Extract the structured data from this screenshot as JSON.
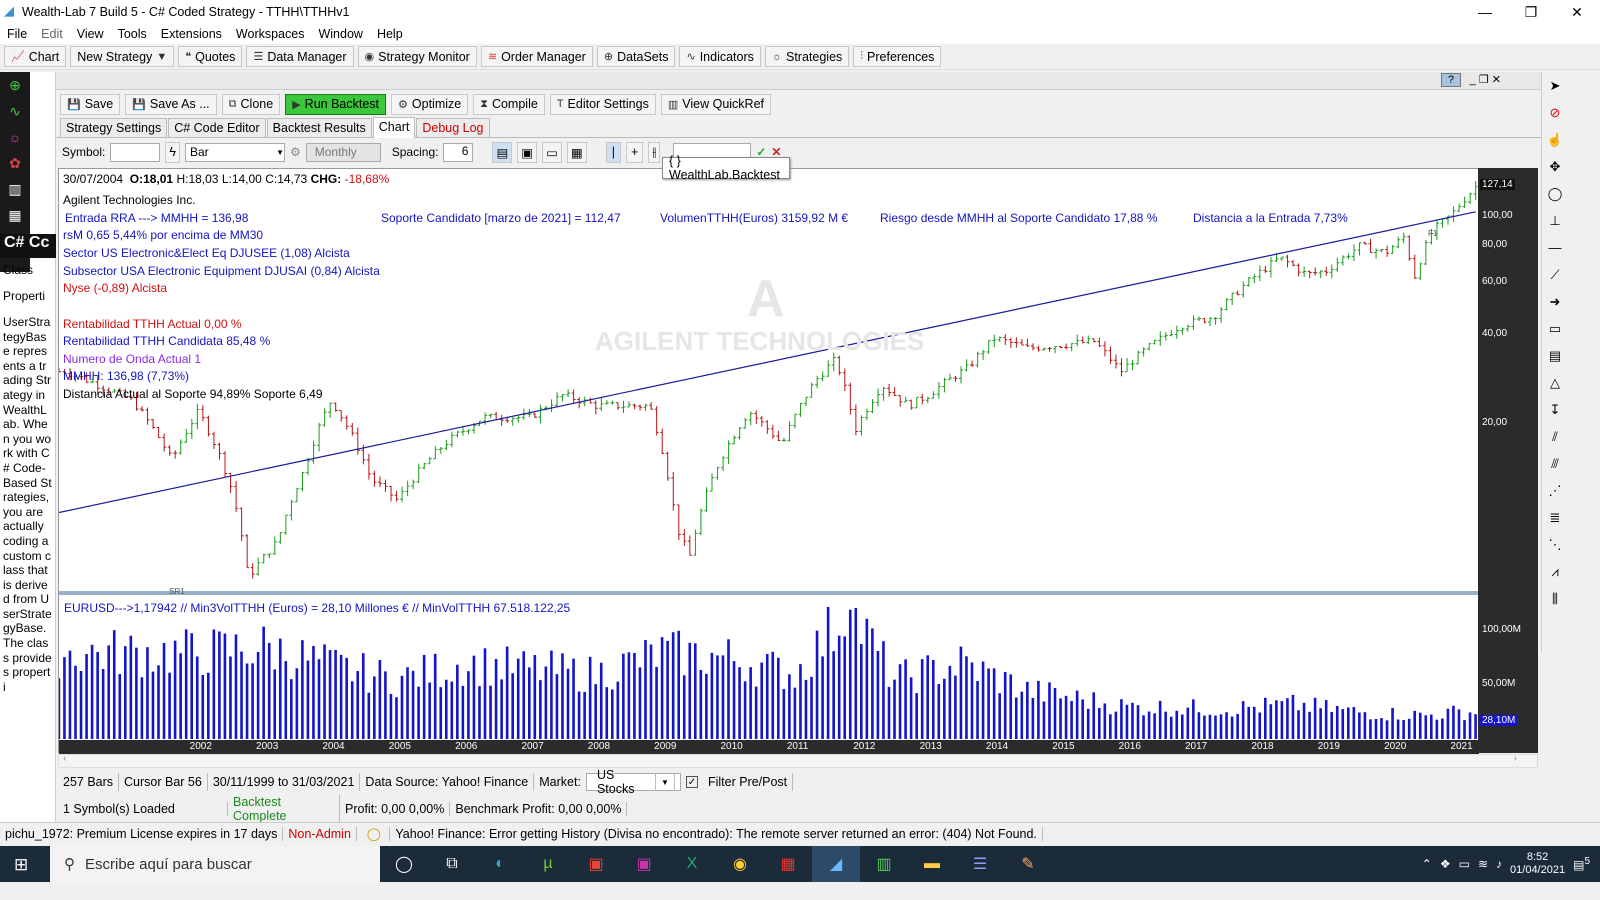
{
  "window": {
    "title": "Wealth-Lab 7 Build 5 - C# Coded Strategy - TTHH\\TTHHv1"
  },
  "menu": [
    "File",
    "Edit",
    "View",
    "Tools",
    "Extensions",
    "Workspaces",
    "Window",
    "Help"
  ],
  "main_toolbar": [
    {
      "label": "Chart",
      "icon": "chart-icon"
    },
    {
      "label": "New Strategy",
      "icon": "dropdown"
    },
    {
      "label": "Quotes",
      "icon": "quotes-icon"
    },
    {
      "label": "Data Manager",
      "icon": "database-icon"
    },
    {
      "label": "Strategy Monitor",
      "icon": "monitor-icon"
    },
    {
      "label": "Order Manager",
      "icon": "wifi-icon"
    },
    {
      "label": "DataSets",
      "icon": "globe-icon"
    },
    {
      "label": "Indicators",
      "icon": "wave-icon"
    },
    {
      "label": "Strategies",
      "icon": "lightbulb-icon"
    },
    {
      "label": "Preferences",
      "icon": "sliders-icon"
    }
  ],
  "left_panel": {
    "code_label": "C# Cc",
    "class_label": "Class",
    "properties_label": "Properti",
    "description": "UserStrategyBase represents a trading Strategy in WealthLab. When you work with C# Code-Based Strategies, you are actually coding a custom class that is derived from UserStrategyBase. The class provides properti"
  },
  "strategy_toolbar": {
    "save": "Save",
    "save_as": "Save As ...",
    "clone": "Clone",
    "run": "Run Backtest",
    "optimize": "Optimize",
    "compile": "Compile",
    "editor_settings": "Editor Settings",
    "quickref": "View QuickRef"
  },
  "tabs": [
    "Strategy Settings",
    "C# Code Editor",
    "Backtest Results",
    "Chart",
    "Debug Log"
  ],
  "chart_toolbar": {
    "symbol_label": "Symbol:",
    "bar_type": "Bar",
    "scale": "Monthly",
    "spacing_label": "Spacing:",
    "spacing_value": "6"
  },
  "tooltip": "{ } WealthLab.Backtest",
  "chart_header": {
    "date": "30/07/2004",
    "o": "O:18,01",
    "h": "H:18,03",
    "l": "L:14,00",
    "c": "C:14,73",
    "chg_label": "CHG:",
    "chg": "-18,68%"
  },
  "annotations": {
    "company": "Agilent Technologies Inc.",
    "entrada": "Entrada RRA --->  MMHH = 136,98",
    "rsm": "rsM 0,65  5,44%  por encima de MM30",
    "sector": "Sector US Electronic&Elect Eq  DJUSEE (1,08) Alcista",
    "subsector": "Subsector USA Electronic Equipment DJUSAI (0,84) Alcista",
    "nyse": "Nyse (-0,89) Alcista",
    "rent_actual": "Rentabilidad TTHH Actual 0,00 %",
    "rent_candidata": "Rentabilidad TTHH Candidata 85,48 %",
    "onda": "Numero de Onda Actual 1",
    "mmhh": "MMHH: 136,98 (7,73%)",
    "distancia_soporte": "Distancia Actual al Soporte  94,89%  Soporte 6,49",
    "soporte_candidato": "Soporte Candidato  [marzo de 2021] = 112,47",
    "volumen": "VolumenTTHH(Euros) 3159,92 M €",
    "riesgo": "Riesgo desde MMHH al Soporte Candidato 17,88 %",
    "distancia_entrada": "Distancia a la Entrada 7,73%",
    "watermark_logo": "A",
    "watermark": "AGILENT TECHNOLOGIES",
    "volume_text": "EURUSD--->1,17942  // Min3VolTTHH (Euros) = 28,10 Millones €  //    MinVolTTHH 67.518.122,25",
    "sr1": "SR1",
    "f1": "F1"
  },
  "chart_data": {
    "type": "bar",
    "price_axis": {
      "scale": "log",
      "ticks": [
        "100,00",
        "80,00",
        "60,00",
        "40,00",
        "20,00"
      ],
      "last": "127,14"
    },
    "volume_axis": {
      "ticks": [
        "100,00M",
        "50,00M"
      ],
      "last": "28,10M"
    },
    "x_ticks": [
      "2002",
      "2003",
      "2004",
      "2005",
      "2006",
      "2007",
      "2008",
      "2009",
      "2010",
      "2011",
      "2012",
      "2013",
      "2014",
      "2015",
      "2016",
      "2017",
      "2018",
      "2019",
      "2020",
      "2021"
    ],
    "price_anchors": [
      [
        2000.0,
        30
      ],
      [
        2001.0,
        24
      ],
      [
        2001.6,
        15
      ],
      [
        2002.0,
        22
      ],
      [
        2002.5,
        12
      ],
      [
        2002.75,
        6
      ],
      [
        2003.2,
        8
      ],
      [
        2003.6,
        14
      ],
      [
        2004.0,
        24
      ],
      [
        2004.6,
        13
      ],
      [
        2005.0,
        11
      ],
      [
        2005.7,
        17
      ],
      [
        2006.3,
        21
      ],
      [
        2007.0,
        21
      ],
      [
        2007.5,
        25
      ],
      [
        2008.0,
        23
      ],
      [
        2008.8,
        23
      ],
      [
        2009.2,
        9
      ],
      [
        2009.4,
        7
      ],
      [
        2009.8,
        14
      ],
      [
        2010.3,
        22
      ],
      [
        2010.8,
        17
      ],
      [
        2011.3,
        28
      ],
      [
        2011.6,
        33
      ],
      [
        2011.9,
        19
      ],
      [
        2012.3,
        27
      ],
      [
        2012.7,
        23
      ],
      [
        2013.0,
        25
      ],
      [
        2013.6,
        31
      ],
      [
        2014.0,
        39
      ],
      [
        2014.5,
        36
      ],
      [
        2015.0,
        37
      ],
      [
        2015.5,
        38
      ],
      [
        2015.9,
        30
      ],
      [
        2016.3,
        36
      ],
      [
        2016.8,
        43
      ],
      [
        2017.3,
        46
      ],
      [
        2017.8,
        60
      ],
      [
        2018.3,
        73
      ],
      [
        2018.7,
        64
      ],
      [
        2019.0,
        66
      ],
      [
        2019.5,
        80
      ],
      [
        2019.9,
        76
      ],
      [
        2020.2,
        87
      ],
      [
        2020.3,
        60
      ],
      [
        2020.6,
        90
      ],
      [
        2020.9,
        103
      ],
      [
        2021.25,
        127
      ]
    ],
    "trendline": [
      [
        1999.9,
        6.49
      ],
      [
        2021.25,
        112.47
      ]
    ],
    "volume_peaks": [
      [
        2002,
        80
      ],
      [
        2003,
        85
      ],
      [
        2004,
        68
      ],
      [
        2005,
        55
      ],
      [
        2006,
        70
      ],
      [
        2007,
        65
      ],
      [
        2008,
        60
      ],
      [
        2009,
        80
      ],
      [
        2010,
        75
      ],
      [
        2011,
        60
      ],
      [
        2011.8,
        120
      ],
      [
        2012.5,
        55
      ],
      [
        2013.5,
        70
      ],
      [
        2014.5,
        45
      ],
      [
        2016,
        30
      ],
      [
        2017.5,
        28
      ],
      [
        2018.5,
        32
      ],
      [
        2019.5,
        25
      ],
      [
        2020.5,
        22
      ],
      [
        2021,
        25
      ]
    ]
  },
  "status_bar1": {
    "bars": "257 Bars",
    "cursor": "Cursor Bar 56",
    "range": "30/11/1999 to 31/03/2021",
    "source": "Data Source: Yahoo! Finance",
    "market_label": "Market:",
    "market": "US Stocks",
    "filter": "Filter Pre/Post"
  },
  "status_bar2": {
    "loaded": "1 Symbol(s) Loaded",
    "backtest": "Backtest Complete",
    "profit": "Profit:  0,00  0,00%",
    "benchmark": "Benchmark Profit:  0,00  0,00%"
  },
  "status_bar3": {
    "license": "pichu_1972: Premium License expires in 17 days",
    "admin": "Non-Admin",
    "error": "Yahoo! Finance: Error getting History (Divisa no encontrado): The remote server returned an error: (404) Not Found."
  },
  "taskbar": {
    "search_placeholder": "Escribe aquí para buscar",
    "time": "8:52",
    "date": "01/04/2021",
    "notifications": "5"
  },
  "colors": {
    "up_bar": "#1b9a1b",
    "down_bar": "#b31414",
    "volume": "#1414c8",
    "trendline": "#1a1a9a",
    "axis_bg": "#2b2b2b"
  }
}
